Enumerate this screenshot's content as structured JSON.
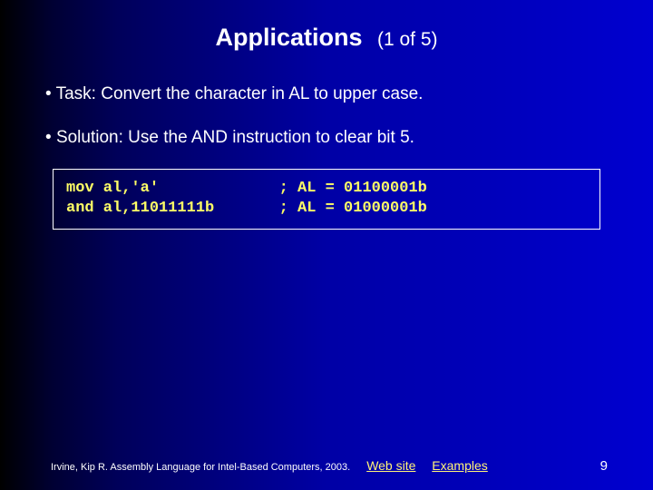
{
  "header": {
    "title": "Applications",
    "subtitle": "(1 of 5)"
  },
  "bullets": [
    "Task: Convert the character in AL to upper case.",
    "Solution: Use the AND instruction to clear bit 5."
  ],
  "code": "mov al,'a'             ; AL = 01100001b\nand al,11011111b       ; AL = 01000001b",
  "footer": {
    "credit": "Irvine, Kip R. Assembly Language for Intel-Based Computers, 2003.",
    "link_web": "Web site",
    "link_examples": "Examples",
    "page": "9"
  }
}
